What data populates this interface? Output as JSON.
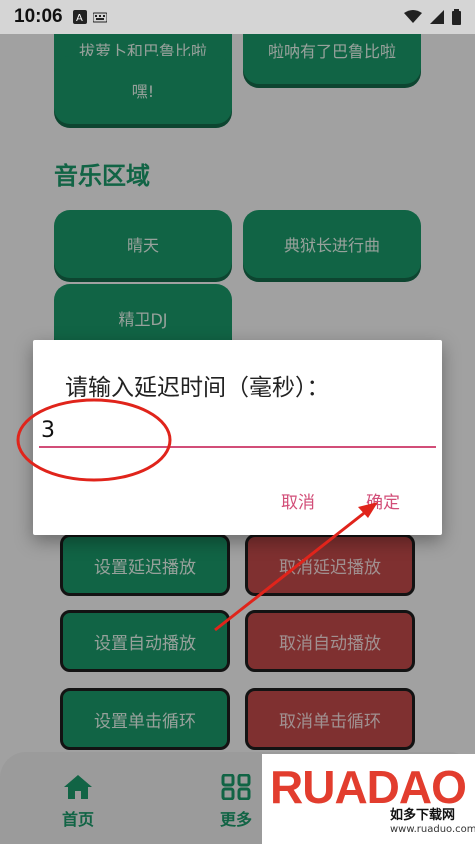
{
  "status_bar": {
    "time": "10:06"
  },
  "app": {
    "top_buttons": [
      "拔萝卜和巴鲁比啦",
      "啦呐有了巴鲁比啦"
    ],
    "hey_button": "嘿!",
    "section_music": "音乐区域",
    "music_buttons": [
      "晴天",
      "典狱长进行曲",
      "精卫DJ"
    ],
    "controls": {
      "set_delay": "设置延迟播放",
      "cancel_delay": "取消延迟播放",
      "set_auto": "设置自动播放",
      "cancel_auto": "取消自动播放",
      "set_loop": "设置单击循环",
      "cancel_loop": "取消单击循环"
    },
    "nav": {
      "home": "首页",
      "more": "更多"
    }
  },
  "dialog": {
    "title": "请输入延迟时间（毫秒）：",
    "input_value": "3",
    "cancel": "取消",
    "confirm": "确定"
  },
  "watermark": {
    "brand": "RUADAO",
    "cn": "如多下载网",
    "url": "www.ruaduo.com"
  },
  "colors": {
    "accent_green": "#1b9a6a",
    "cancel_red": "#c44b4b",
    "dialog_accent": "#d24e78",
    "annotation_red": "#e0241b"
  }
}
